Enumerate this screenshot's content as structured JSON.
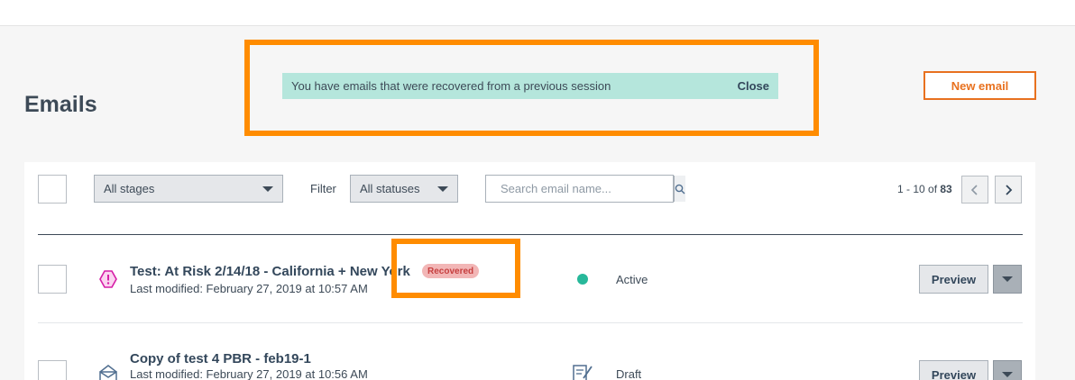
{
  "page": {
    "title": "Emails"
  },
  "notice": {
    "message": "You have emails that were recovered from a previous session",
    "close_label": "Close"
  },
  "toolbar": {
    "new_email_label": "New email",
    "stages_dropdown": "All stages",
    "filter_label": "Filter",
    "statuses_dropdown": "All statuses",
    "search_placeholder": "Search email name...",
    "pagination": {
      "range": "1 - 10 of ",
      "total": "83"
    }
  },
  "emails": [
    {
      "name": "Test: At Risk 2/14/18 - California + New York",
      "modified": "Last modified: February 27, 2019 at 10:57 AM",
      "badge": "Recovered",
      "status": "Active",
      "preview_label": "Preview",
      "icon": "alert-hexagon-icon"
    },
    {
      "name": "Copy of test 4 PBR - feb19-1",
      "modified": "Last modified: February 27, 2019 at 10:56 AM",
      "status": "Draft",
      "preview_label": "Preview",
      "icon": "envelope-open-icon"
    }
  ],
  "colors": {
    "highlight": "#ff8c00",
    "accent": "#e8711f",
    "notice_bg": "#b5e6dc",
    "active": "#27b89a",
    "alert": "#d61fa7"
  }
}
